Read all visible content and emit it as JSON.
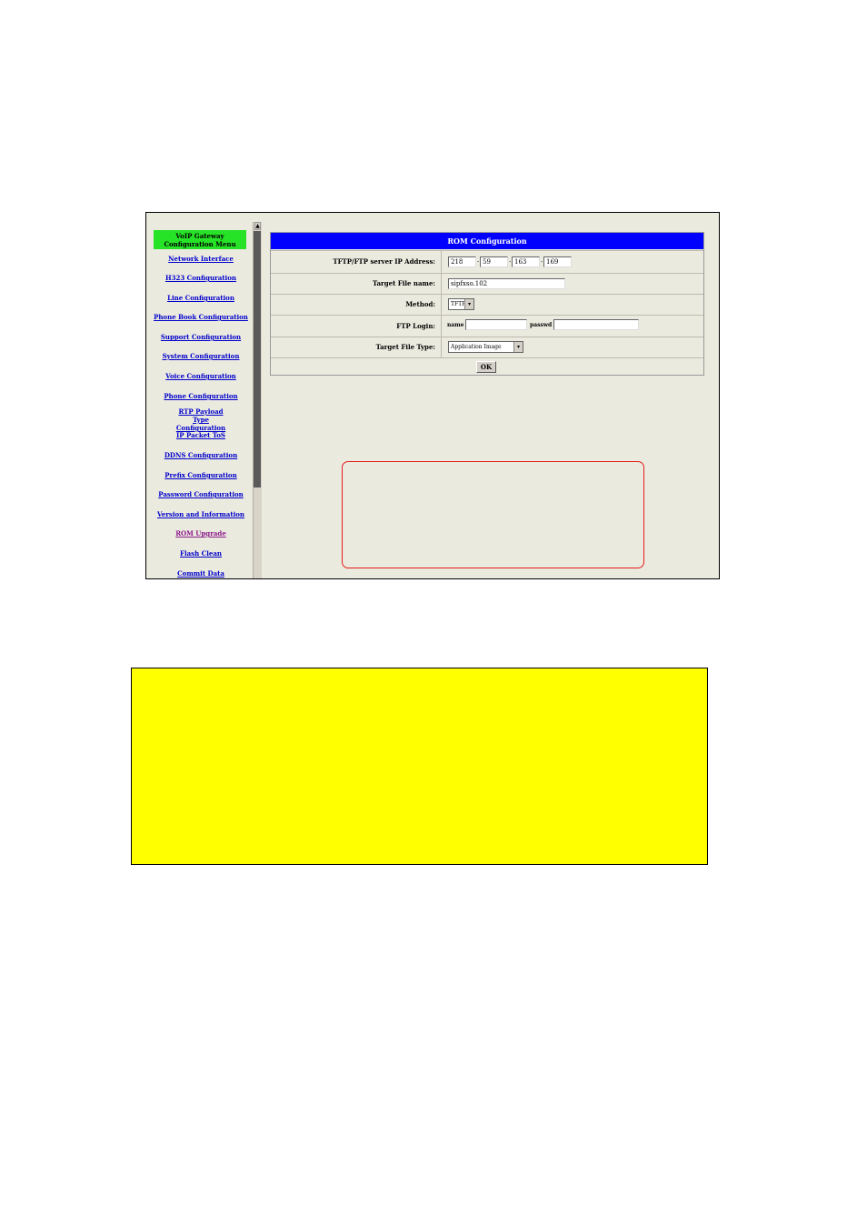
{
  "menu": {
    "header": "VoIP Gateway Configuration Menu",
    "items": [
      {
        "label": "Network Interface"
      },
      {
        "label": "H323 Configuration"
      },
      {
        "label": "Line Configuration"
      },
      {
        "label": "Phone Book Configuration"
      },
      {
        "label": "Support Configuration"
      },
      {
        "label": "System Configuration"
      },
      {
        "label": "Voice Configuration"
      },
      {
        "label": "Phone Configuration"
      },
      {
        "label": "RTP Payload Type Configuration"
      },
      {
        "label": "IP Packet ToS"
      },
      {
        "label": "DDNS Configuration"
      },
      {
        "label": "Prefix Configuration"
      },
      {
        "label": "Password Configuration"
      },
      {
        "label": "Version and Information"
      },
      {
        "label": "ROM Upgrade"
      },
      {
        "label": "Flash Clean"
      },
      {
        "label": "Commit Data"
      }
    ]
  },
  "rom": {
    "title": "ROM Configuration",
    "ip_label": "TFTP/FTP server IP Address:",
    "ip": [
      "218",
      "59",
      "163",
      "169"
    ],
    "ip_sep": ".",
    "file_label": "Target File name:",
    "file_value": "sipfxso.102",
    "method_label": "Method:",
    "method_value": "TFTP",
    "login_label": "FTP Login:",
    "name_label": "name",
    "passwd_label": "passwd",
    "type_label": "Target File Type:",
    "type_value": "Application Image",
    "ok_label": "OK"
  }
}
